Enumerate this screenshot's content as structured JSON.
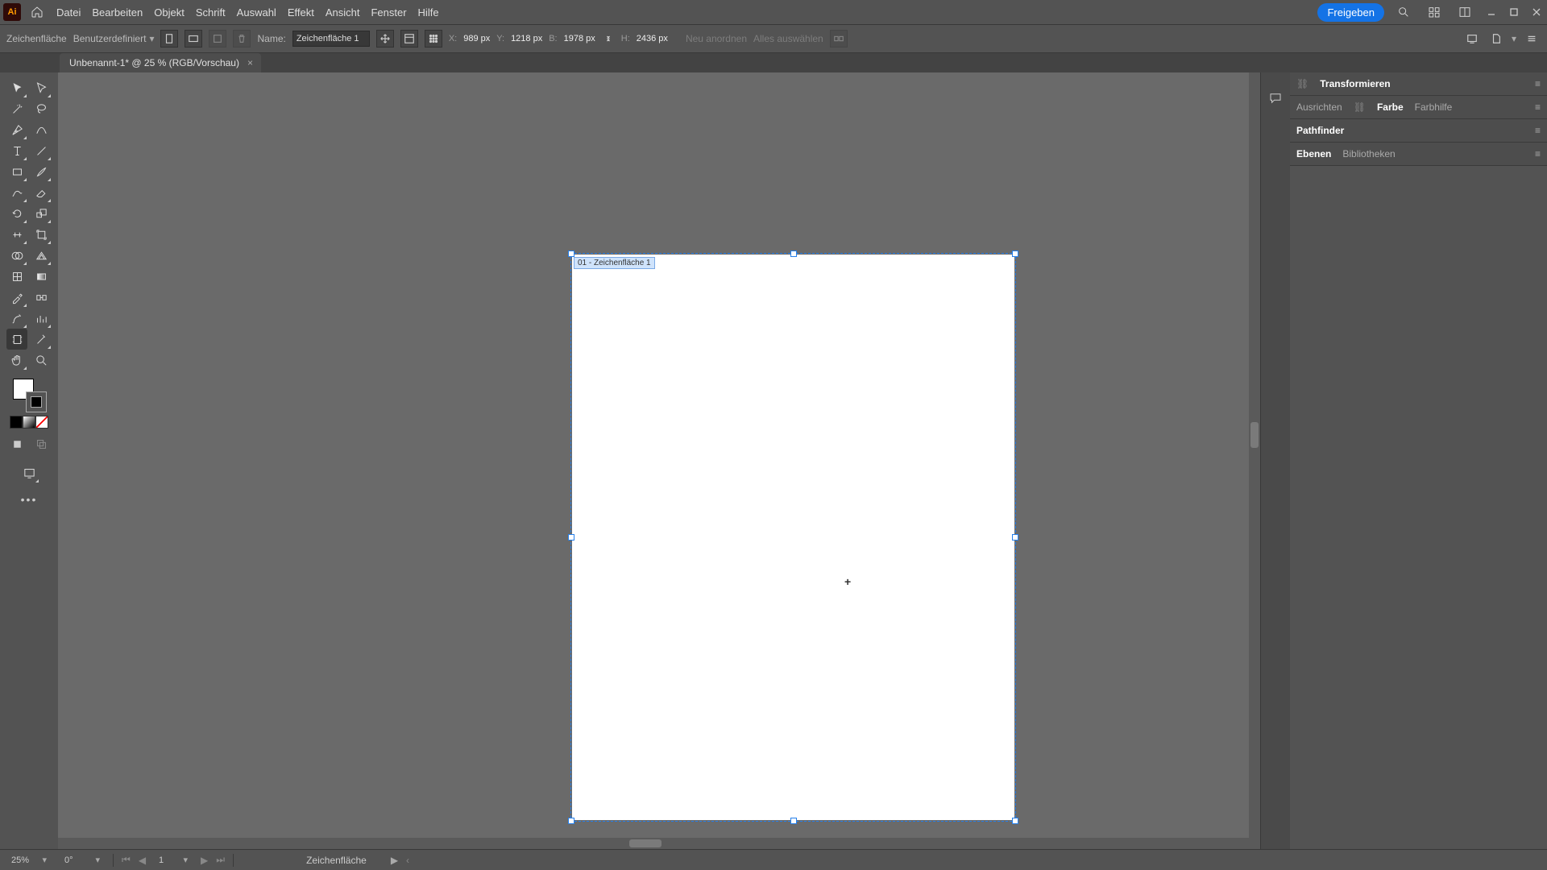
{
  "app": {
    "logo_text": "Ai"
  },
  "menubar": {
    "items": [
      "Datei",
      "Bearbeiten",
      "Objekt",
      "Schrift",
      "Auswahl",
      "Effekt",
      "Ansicht",
      "Fenster",
      "Hilfe"
    ],
    "share": "Freigeben"
  },
  "controlbar": {
    "tool_label": "Zeichenfläche",
    "preset": "Benutzerdefiniert",
    "name_label": "Name:",
    "name_value": "Zeichenfläche 1",
    "x_label": "X:",
    "x_value": "989 px",
    "y_label": "Y:",
    "y_value": "1218 px",
    "w_label": "B:",
    "w_value": "1978 px",
    "h_label": "H:",
    "h_value": "2436 px",
    "rearrange": "Neu anordnen",
    "select_all": "Alles auswählen"
  },
  "document": {
    "tab_title": "Unbenannt-1* @ 25 % (RGB/Vorschau)",
    "artboard_label": "01 - Zeichenfläche 1"
  },
  "panels": {
    "transform": {
      "title": "Transformieren"
    },
    "row2": {
      "tabs": [
        "Ausrichten",
        "Farbe",
        "Farbhilfe"
      ],
      "active": 1
    },
    "row3": {
      "tabs": [
        "Pathfinder"
      ],
      "active": 0
    },
    "row4": {
      "tabs": [
        "Ebenen",
        "Bibliotheken"
      ],
      "active": 0
    }
  },
  "status": {
    "zoom": "25%",
    "rotation": "0°",
    "artboard_nav": "1",
    "mode": "Zeichenfläche"
  },
  "icons": {
    "home": "home",
    "search": "search",
    "layout1": "layout1",
    "layout2": "layout2",
    "min": "min",
    "max": "max",
    "close": "close"
  }
}
